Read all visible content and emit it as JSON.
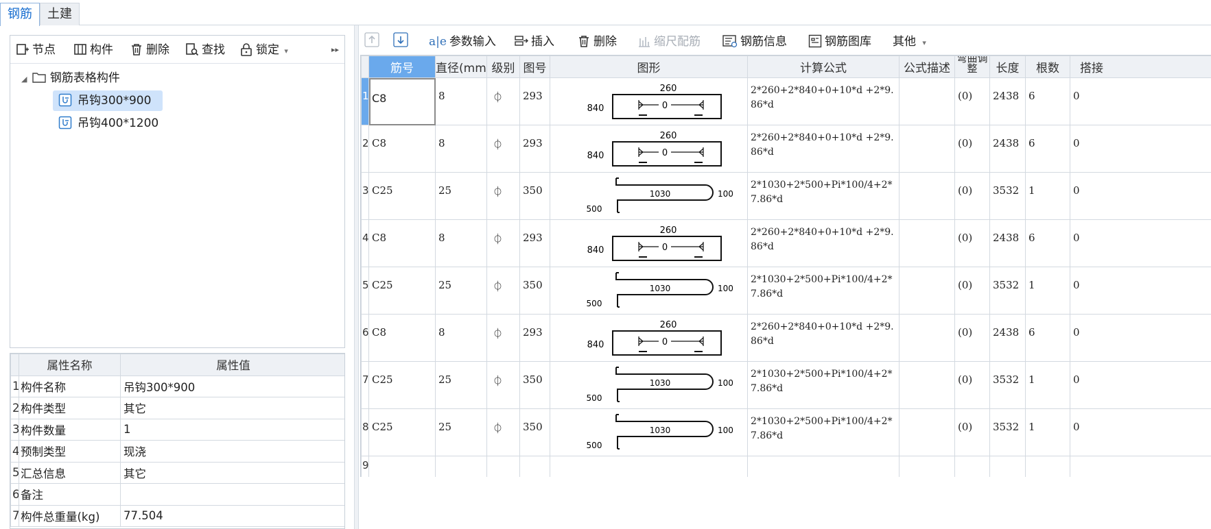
{
  "tabs": [
    {
      "label": "钢筋",
      "active": true
    },
    {
      "label": "土建",
      "active": false
    }
  ],
  "left_toolbar": {
    "node": "节点",
    "component": "构件",
    "delete": "删除",
    "find": "查找",
    "lock": "锁定"
  },
  "tree": {
    "folder": "钢筋表格构件",
    "items": [
      {
        "label": "吊钩300*900",
        "selected": true
      },
      {
        "label": "吊钩400*1200",
        "selected": false
      }
    ]
  },
  "props": {
    "headers": [
      "属性名称",
      "属性值"
    ],
    "rows": [
      {
        "num": "1",
        "name": "构件名称",
        "value": "吊钩300*900"
      },
      {
        "num": "2",
        "name": "构件类型",
        "value": "其它"
      },
      {
        "num": "3",
        "name": "构件数量",
        "value": "1"
      },
      {
        "num": "4",
        "name": "预制类型",
        "value": "现浇"
      },
      {
        "num": "5",
        "name": "汇总信息",
        "value": "其它"
      },
      {
        "num": "6",
        "name": "备注",
        "value": ""
      },
      {
        "num": "7",
        "name": "构件总重量(kg)",
        "value": "77.504"
      }
    ]
  },
  "right_toolbar": {
    "param_input": "参数输入",
    "insert": "插入",
    "delete": "删除",
    "scale": "缩尺配筋",
    "rebar_info": "钢筋信息",
    "rebar_lib": "钢筋图库",
    "other": "其他"
  },
  "table": {
    "headers": [
      "筋号",
      "直径(mm)",
      "级别",
      "图号",
      "图形",
      "计算公式",
      "公式描述",
      "弯曲调整",
      "长度",
      "根数",
      "搭接"
    ],
    "grade_symbol": "⏀",
    "rows": [
      {
        "num": "1",
        "bar": "C8",
        "dia": "8",
        "shape_no": "293",
        "formula": "2*260+2*840+0+10*d +2*9.86*d",
        "adjust": "(0)",
        "length": "2438",
        "count": "6",
        "lap": "0",
        "shape": {
          "type": "hook293",
          "top": "260",
          "side": "840",
          "mid": "0"
        }
      },
      {
        "num": "2",
        "bar": "C8",
        "dia": "8",
        "shape_no": "293",
        "formula": "2*260+2*840+0+10*d +2*9.86*d",
        "adjust": "(0)",
        "length": "2438",
        "count": "6",
        "lap": "0",
        "shape": {
          "type": "hook293",
          "top": "260",
          "side": "840",
          "mid": "0"
        }
      },
      {
        "num": "3",
        "bar": "C25",
        "dia": "25",
        "shape_no": "350",
        "formula": "2*1030+2*500+Pi*100/4+2*7.86*d",
        "adjust": "(0)",
        "length": "3532",
        "count": "1",
        "lap": "0",
        "shape": {
          "type": "hook350",
          "len": "1030",
          "radius": "100",
          "side": "500"
        }
      },
      {
        "num": "4",
        "bar": "C8",
        "dia": "8",
        "shape_no": "293",
        "formula": "2*260+2*840+0+10*d +2*9.86*d",
        "adjust": "(0)",
        "length": "2438",
        "count": "6",
        "lap": "0",
        "shape": {
          "type": "hook293",
          "top": "260",
          "side": "840",
          "mid": "0"
        }
      },
      {
        "num": "5",
        "bar": "C25",
        "dia": "25",
        "shape_no": "350",
        "formula": "2*1030+2*500+Pi*100/4+2*7.86*d",
        "adjust": "(0)",
        "length": "3532",
        "count": "1",
        "lap": "0",
        "shape": {
          "type": "hook350",
          "len": "1030",
          "radius": "100",
          "side": "500"
        }
      },
      {
        "num": "6",
        "bar": "C8",
        "dia": "8",
        "shape_no": "293",
        "formula": "2*260+2*840+0+10*d +2*9.86*d",
        "adjust": "(0)",
        "length": "2438",
        "count": "6",
        "lap": "0",
        "shape": {
          "type": "hook293",
          "top": "260",
          "side": "840",
          "mid": "0"
        }
      },
      {
        "num": "7",
        "bar": "C25",
        "dia": "25",
        "shape_no": "350",
        "formula": "2*1030+2*500+Pi*100/4+2*7.86*d",
        "adjust": "(0)",
        "length": "3532",
        "count": "1",
        "lap": "0",
        "shape": {
          "type": "hook350",
          "len": "1030",
          "radius": "100",
          "side": "500"
        }
      },
      {
        "num": "8",
        "bar": "C25",
        "dia": "25",
        "shape_no": "350",
        "formula": "2*1030+2*500+Pi*100/4+2*7.86*d",
        "adjust": "(0)",
        "length": "3532",
        "count": "1",
        "lap": "0",
        "shape": {
          "type": "hook350",
          "len": "1030",
          "radius": "100",
          "side": "500"
        }
      }
    ],
    "empty_row_num": "9"
  }
}
